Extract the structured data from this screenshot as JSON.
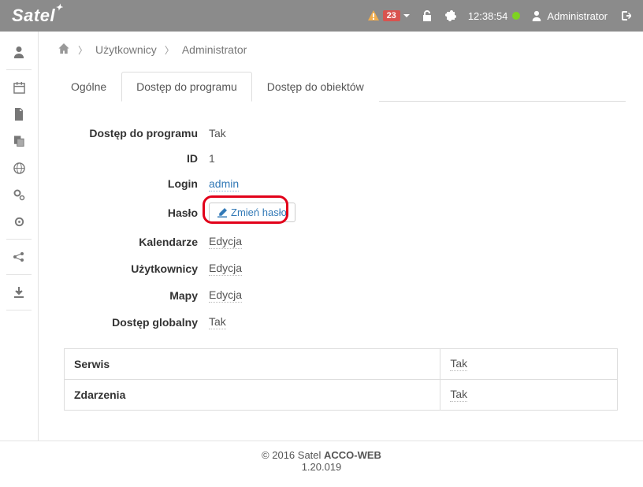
{
  "topbar": {
    "logo": "Satel",
    "notif_count": "23",
    "time": "12:38:54",
    "user_label": "Administrator"
  },
  "breadcrumb": {
    "item1": "Użytkownicy",
    "item2": "Administrator"
  },
  "tabs": {
    "t0": "Ogólne",
    "t1": "Dostęp do programu",
    "t2": "Dostęp do obiektów"
  },
  "form": {
    "access_label": "Dostęp do programu",
    "access_value": "Tak",
    "id_label": "ID",
    "id_value": "1",
    "login_label": "Login",
    "login_value": "admin",
    "pass_label": "Hasło",
    "pass_btn": "Zmień hasło",
    "cal_label": "Kalendarze",
    "cal_value": "Edycja",
    "users_label": "Użytkownicy",
    "users_value": "Edycja",
    "maps_label": "Mapy",
    "maps_value": "Edycja",
    "global_label": "Dostęp globalny",
    "global_value": "Tak"
  },
  "table": {
    "r0c0": "Serwis",
    "r0c1": "Tak",
    "r1c0": "Zdarzenia",
    "r1c1": "Tak"
  },
  "footer": {
    "copy_prefix": "© 2016 Satel ",
    "copy_bold": "ACCO-WEB",
    "version": "1.20.019"
  }
}
